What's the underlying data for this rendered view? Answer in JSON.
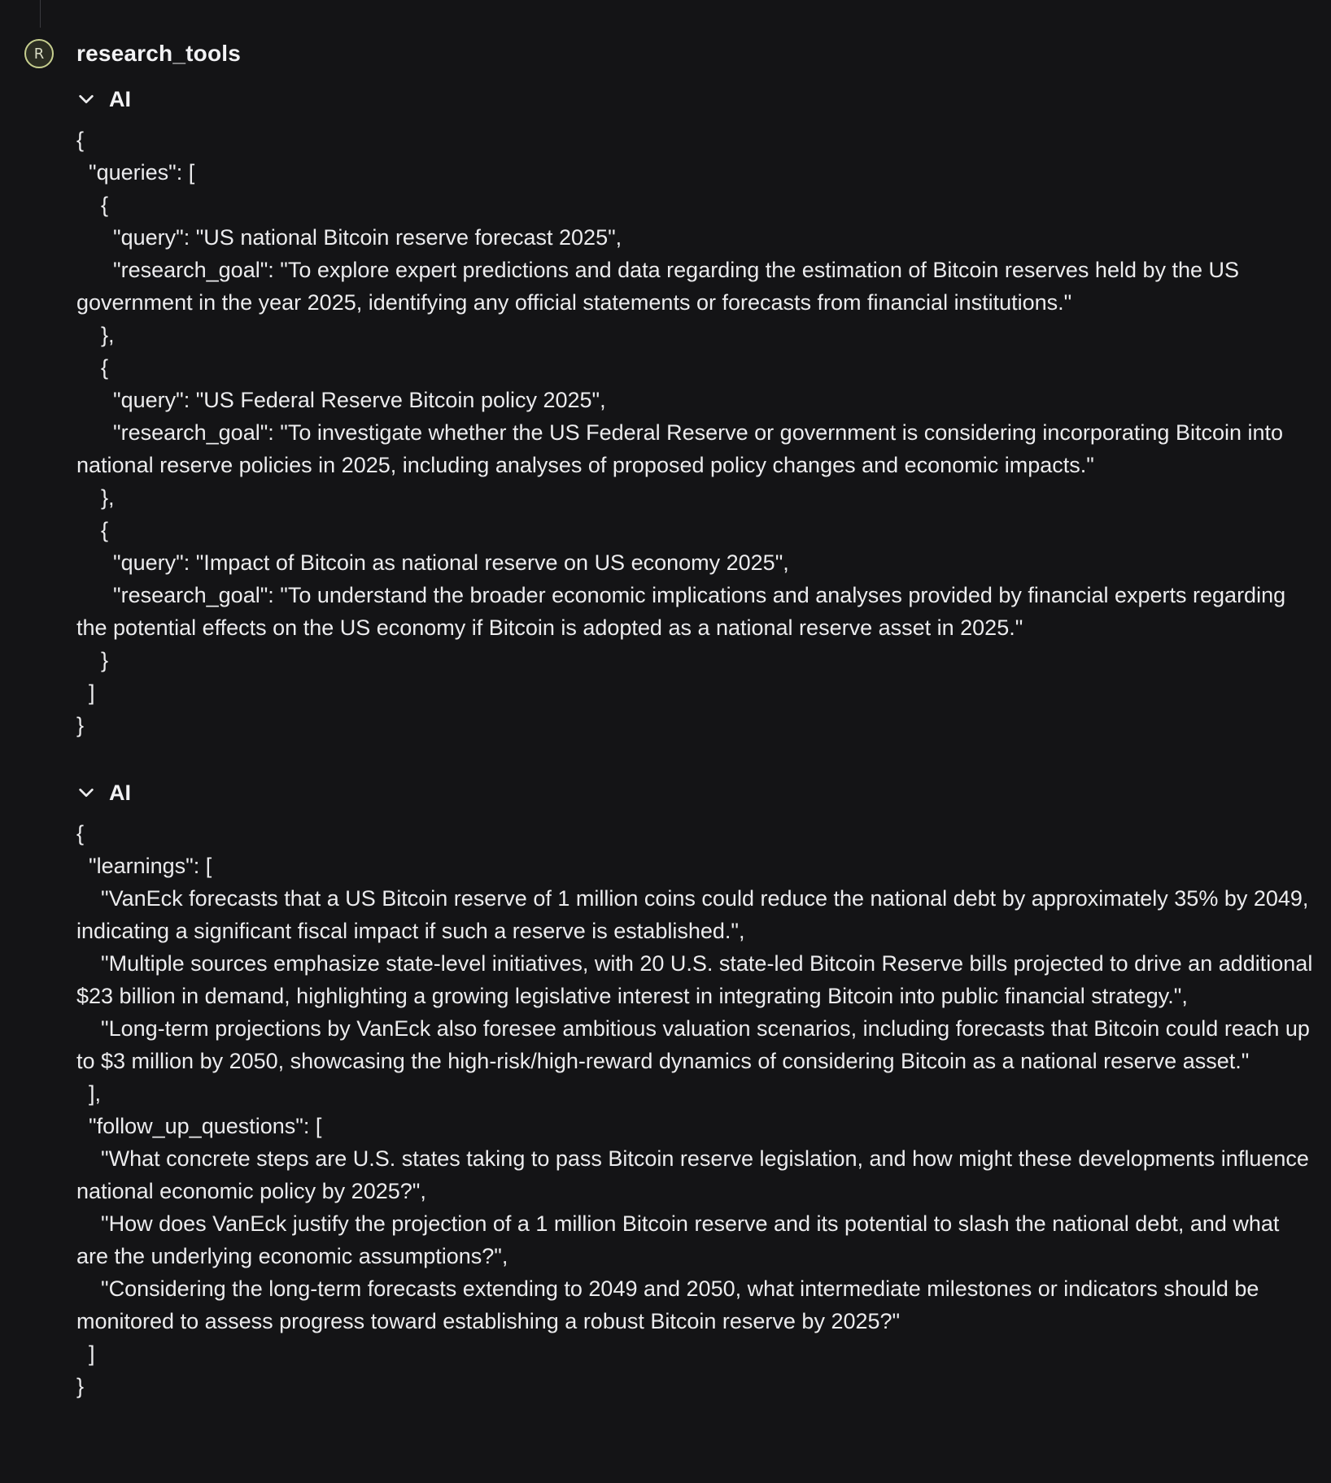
{
  "header": {
    "avatar_letter": "R",
    "agent_name": "research_tools"
  },
  "sections": [
    {
      "label": "AI",
      "icon": "chevron-down-icon",
      "json_text": "{\n  \"queries\": [\n    {\n      \"query\": \"US national Bitcoin reserve forecast 2025\",\n      \"research_goal\": \"To explore expert predictions and data regarding the estimation of Bitcoin reserves held by the US government in the year 2025, identifying any official statements or forecasts from financial institutions.\"\n    },\n    {\n      \"query\": \"US Federal Reserve Bitcoin policy 2025\",\n      \"research_goal\": \"To investigate whether the US Federal Reserve or government is considering incorporating Bitcoin into national reserve policies in 2025, including analyses of proposed policy changes and economic impacts.\"\n    },\n    {\n      \"query\": \"Impact of Bitcoin as national reserve on US economy 2025\",\n      \"research_goal\": \"To understand the broader economic implications and analyses provided by financial experts regarding the potential effects on the US economy if Bitcoin is adopted as a national reserve asset in 2025.\"\n    }\n  ]\n}"
    },
    {
      "label": "AI",
      "icon": "chevron-down-icon",
      "json_text": "{\n  \"learnings\": [\n    \"VanEck forecasts that a US Bitcoin reserve of 1 million coins could reduce the national debt by approximately 35% by 2049, indicating a significant fiscal impact if such a reserve is established.\",\n    \"Multiple sources emphasize state-level initiatives, with 20 U.S. state-led Bitcoin Reserve bills projected to drive an additional $23 billion in demand, highlighting a growing legislative interest in integrating Bitcoin into public financial strategy.\",\n    \"Long-term projections by VanEck also foresee ambitious valuation scenarios, including forecasts that Bitcoin could reach up to $3 million by 2050, showcasing the high-risk/high-reward dynamics of considering Bitcoin as a national reserve asset.\"\n  ],\n  \"follow_up_questions\": [\n    \"What concrete steps are U.S. states taking to pass Bitcoin reserve legislation, and how might these developments influence national economic policy by 2025?\",\n    \"How does VanEck justify the projection of a 1 million Bitcoin reserve and its potential to slash the national debt, and what are the underlying economic assumptions?\",\n    \"Considering the long-term forecasts extending to 2049 and 2050, what intermediate milestones or indicators should be monitored to assess progress toward establishing a robust Bitcoin reserve by 2025?\"\n  ]\n}"
    }
  ],
  "colors": {
    "background": "#141416",
    "text": "#ececee",
    "avatar_border": "#c7cf8f"
  }
}
